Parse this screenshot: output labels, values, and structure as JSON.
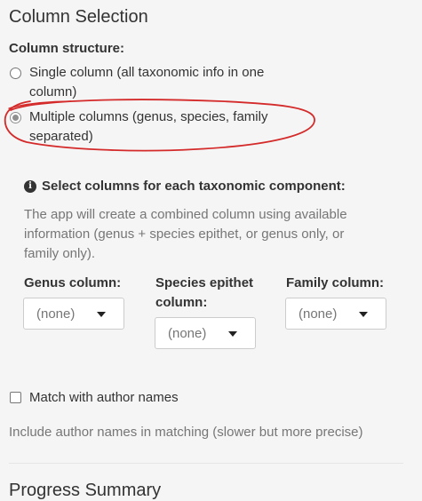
{
  "section_title": "Column Selection",
  "structure": {
    "label": "Column structure:",
    "options": [
      {
        "label": "Single column (all taxonomic info in one column)",
        "checked": false
      },
      {
        "label": "Multiple columns (genus, species, family separated)",
        "checked": true
      }
    ]
  },
  "info": {
    "icon": "info-circle-icon",
    "heading": "Select columns for each taxonomic component:",
    "help": "The app will create a combined column using available information (genus + species epithet, or genus only, or family only)."
  },
  "columns": {
    "genus": {
      "label": "Genus column:",
      "value": "(none)"
    },
    "species": {
      "label": "Species epithet column:",
      "value": "(none)"
    },
    "family": {
      "label": "Family column:",
      "value": "(none)"
    }
  },
  "author": {
    "checkbox_label": "Match with author names",
    "checked": false,
    "help": "Include author names in matching (slower but more precise)"
  },
  "next_section_title": "Progress Summary",
  "colors": {
    "annotation_circle": "#d42a2a",
    "background": "#f5f5f5",
    "muted_text": "#767676"
  }
}
